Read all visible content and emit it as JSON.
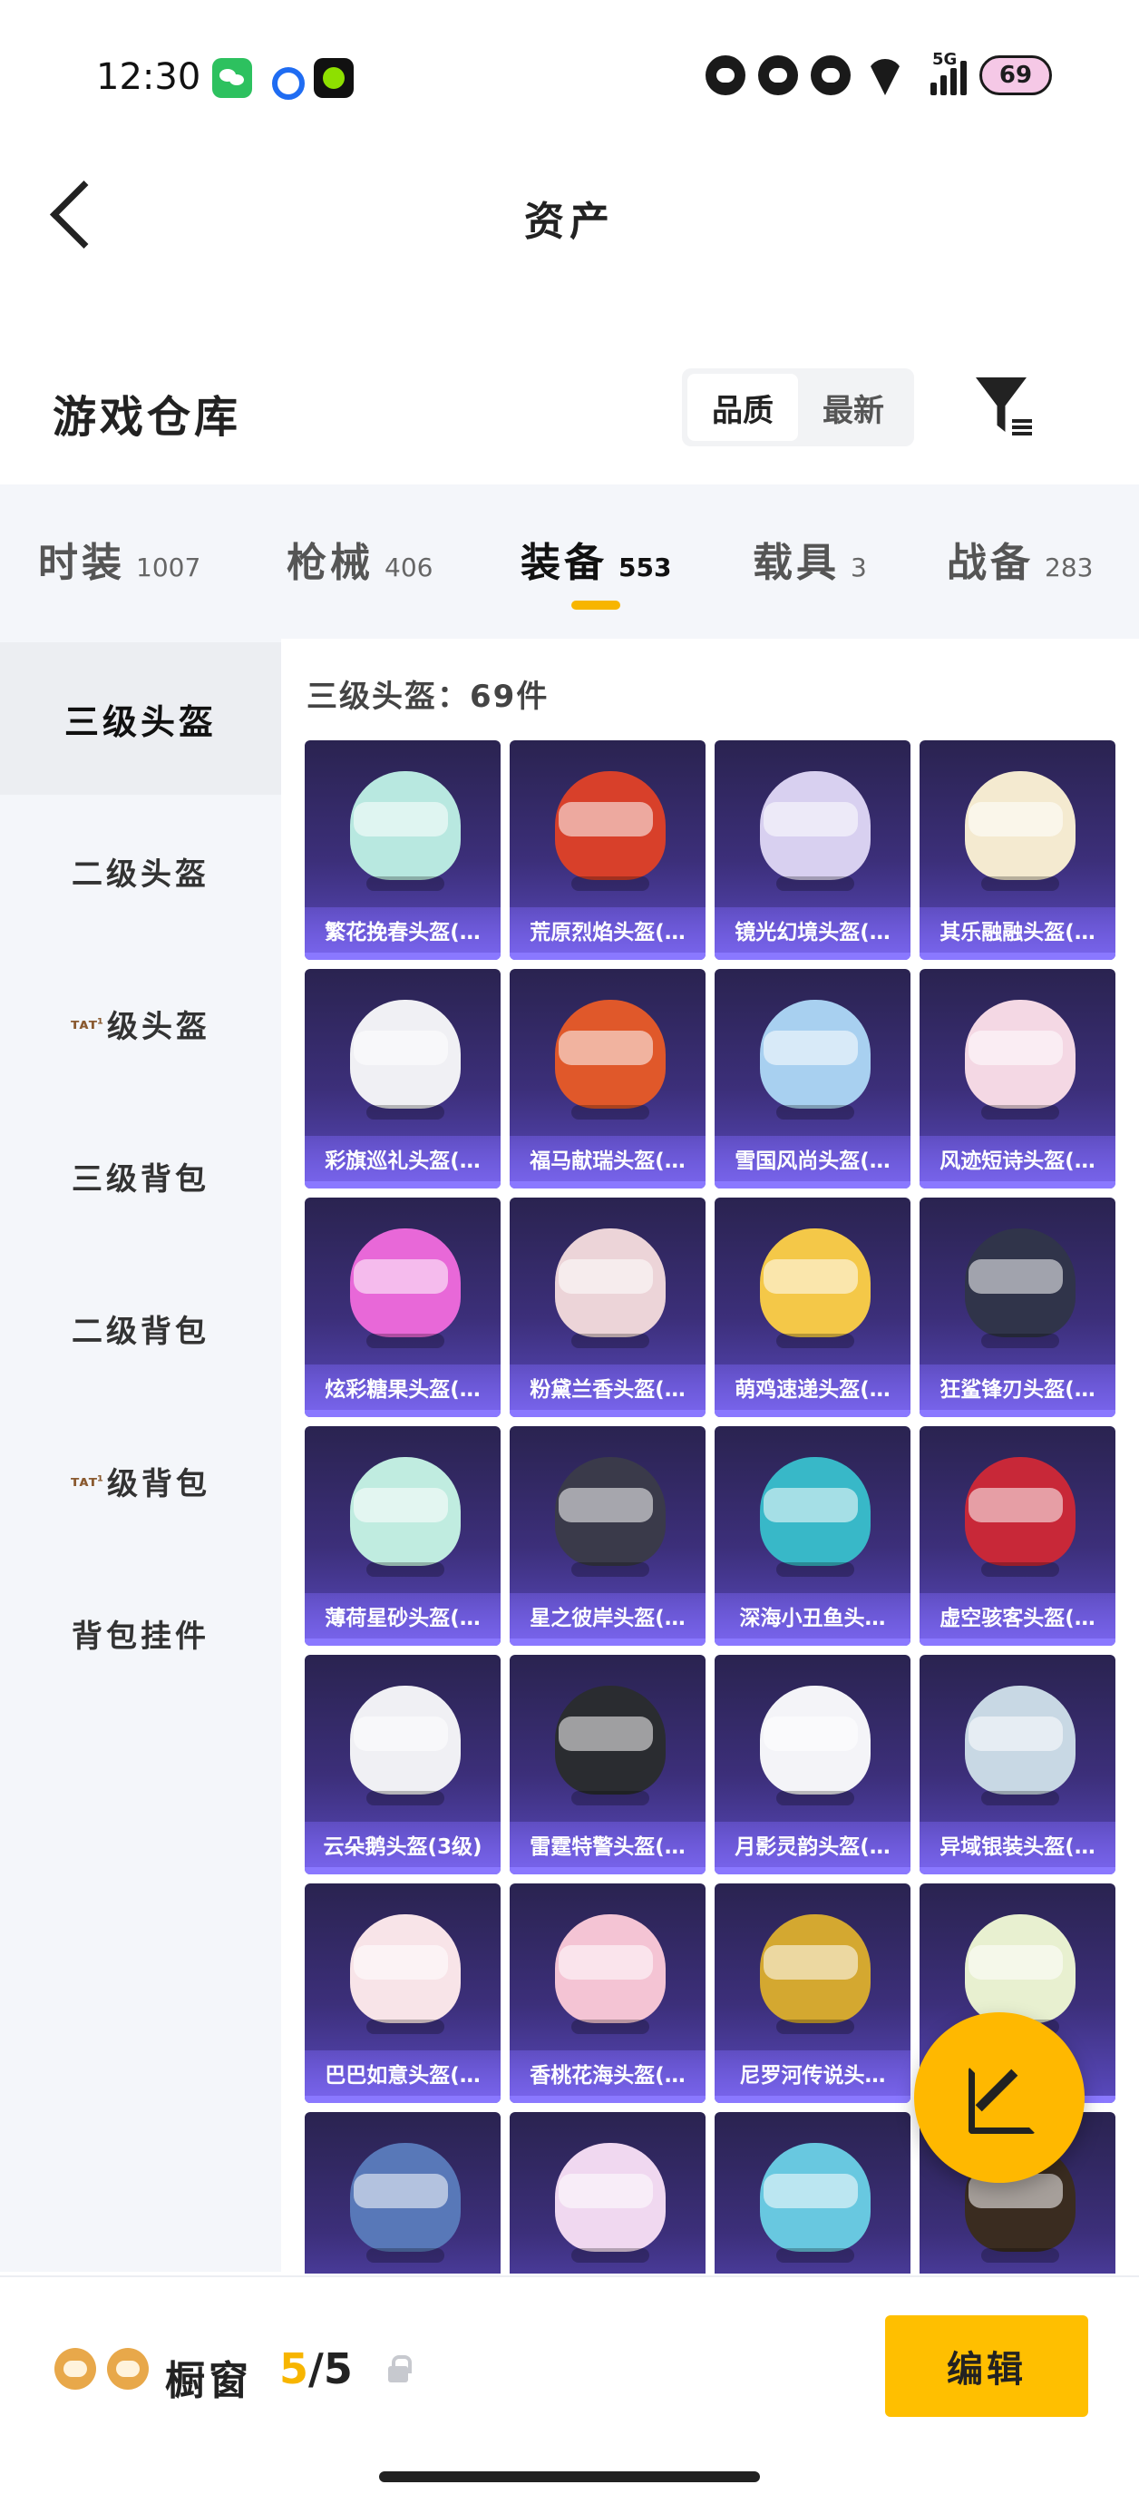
{
  "status_bar": {
    "time": "12:30",
    "network": "5G",
    "battery": "69"
  },
  "header": {
    "title": "资产"
  },
  "warehouse": {
    "title": "游戏仓库",
    "sort_options": [
      "品质",
      "最新"
    ],
    "active_sort": "品质"
  },
  "category_tabs": [
    {
      "label": "时装",
      "count": "1007"
    },
    {
      "label": "枪械",
      "count": "406"
    },
    {
      "label": "装备",
      "count": "553",
      "active": true
    },
    {
      "label": "载具",
      "count": "3"
    },
    {
      "label": "战备",
      "count": "283"
    }
  ],
  "side_nav": {
    "items": [
      {
        "label": "三级头盔",
        "active": true
      },
      {
        "label": "二级头盔"
      },
      {
        "label": "级头盔",
        "prefix": "ᴛᴀᴛ¹"
      },
      {
        "label": "三级背包"
      },
      {
        "label": "二级背包"
      },
      {
        "label": "级背包",
        "prefix": "ᴛᴀᴛ¹"
      },
      {
        "label": "背包挂件"
      }
    ]
  },
  "section": {
    "label": "三级头盔：69件"
  },
  "items": [
    {
      "name": "繁花挽春头盔(…",
      "color": "#b8e8e0"
    },
    {
      "name": "荒原烈焰头盔(…",
      "color": "#d8402a"
    },
    {
      "name": "镜光幻境头盔(…",
      "color": "#d8d0f0"
    },
    {
      "name": "其乐融融头盔(…",
      "color": "#f4ead0"
    },
    {
      "name": "彩旗巡礼头盔(…",
      "color": "#f0f0f4"
    },
    {
      "name": "福马献瑞头盔(…",
      "color": "#e0582a"
    },
    {
      "name": "雪国风尚头盔(…",
      "color": "#a8d0f0"
    },
    {
      "name": "风迹短诗头盔(…",
      "color": "#f4d8e4"
    },
    {
      "name": "炫彩糖果头盔(…",
      "color": "#e868d8"
    },
    {
      "name": "粉黛兰香头盔(…",
      "color": "#ecd4d8"
    },
    {
      "name": "萌鸡速递头盔(…",
      "color": "#f4c848"
    },
    {
      "name": "狂鲨锋刃头盔(…",
      "color": "#30344a"
    },
    {
      "name": "薄荷星砂头盔(…",
      "color": "#c0ece0"
    },
    {
      "name": "星之彼岸头盔(…",
      "color": "#3a3a4a"
    },
    {
      "name": "深海小丑鱼头…",
      "color": "#38b8c8"
    },
    {
      "name": "虚空骇客头盔(…",
      "color": "#c82838"
    },
    {
      "name": "云朵鹅头盔(3级)",
      "color": "#f0f0f4"
    },
    {
      "name": "雷霆特警头盔(…",
      "color": "#2a2c30"
    },
    {
      "name": "月影灵韵头盔(…",
      "color": "#f4f4f8"
    },
    {
      "name": "异域银装头盔(…",
      "color": "#c8d8e4"
    },
    {
      "name": "巴巴如意头盔(…",
      "color": "#f8e4e8"
    },
    {
      "name": "香桃花海头盔(…",
      "color": "#f4c4d4"
    },
    {
      "name": "尼罗河传说头…",
      "color": "#d4a830"
    },
    {
      "name": "",
      "color": "#e8f0d0"
    },
    {
      "name": "",
      "color": "#5878b8"
    },
    {
      "name": "",
      "color": "#f0d8f0"
    },
    {
      "name": "",
      "color": "#68c8e0"
    },
    {
      "name": "",
      "color": "#3a2c20"
    }
  ],
  "bottom_bar": {
    "title": "橱窗",
    "current": "5",
    "separator": "/",
    "total": "5",
    "edit_label": "编辑"
  },
  "colors": {
    "accent": "#ffbf00",
    "card_gradient_top": "#2a2350",
    "card_gradient_bottom": "#5a4ac0"
  }
}
